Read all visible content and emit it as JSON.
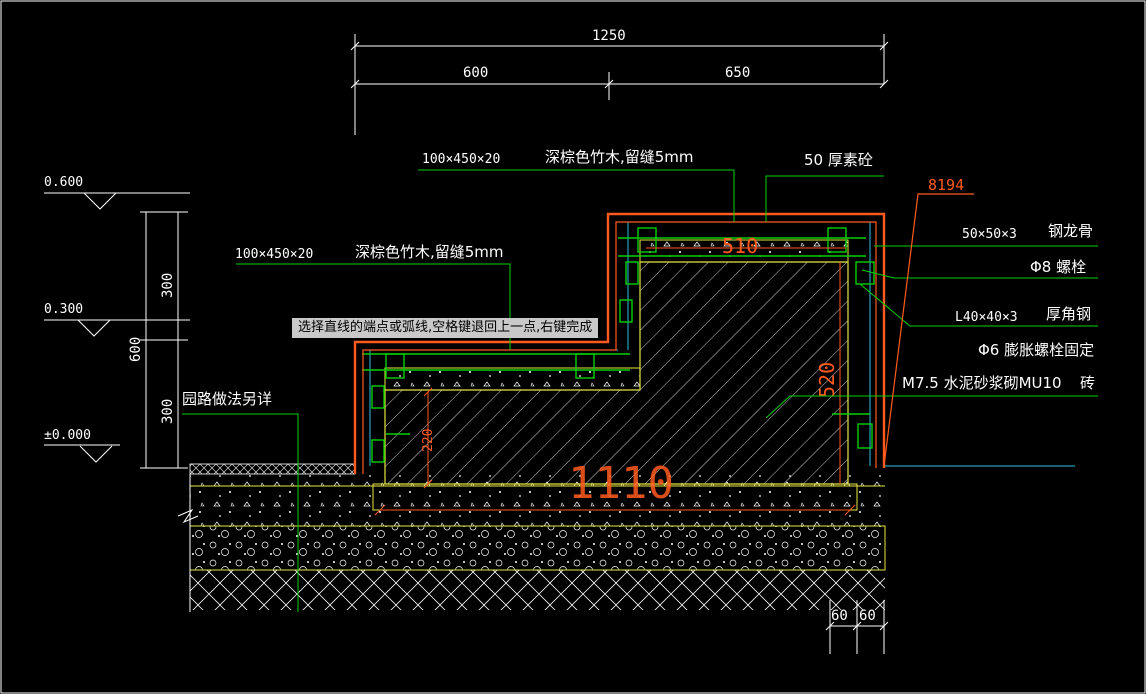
{
  "dimensions": {
    "total": "1250",
    "left": "600",
    "right": "650",
    "h_upper": "300",
    "h_total": "600",
    "h_lower": "300",
    "bottom_a": "60",
    "bottom_b": "60",
    "span_1110": "1110",
    "dim_510": "510",
    "dim_520": "520",
    "dim_220": "220",
    "tag_8194": "8194"
  },
  "levels": {
    "l1": "0.600",
    "l2": "0.300",
    "l3": "±0.000"
  },
  "labels": {
    "top_size": "100×450×20",
    "top_material": "深棕色竹木,留缝5mm",
    "concrete": "50 厚素砼",
    "mid_size": "100×450×20",
    "mid_material": "深棕色竹木,留缝5mm",
    "keel_size": "50×50×3",
    "keel_name": "钢龙骨",
    "bolt": "Φ8 螺栓",
    "angle_size": "L40×40×3",
    "angle_name": "厚角钢",
    "expansion": "Φ6 膨胀螺栓固定",
    "masonry_a": "M7.5 水泥砂浆砌MU10",
    "masonry_b": "砖",
    "road": "园路做法另详"
  },
  "command_prompt": "选择直线的端点或弧线,空格键退回上一点,右键完成",
  "colors": {
    "background": "#000000",
    "outline": "#ff5a1e",
    "green": "#00d000",
    "yellow": "#e6e640",
    "cyan": "#29c3e0",
    "white": "#ffffff"
  }
}
